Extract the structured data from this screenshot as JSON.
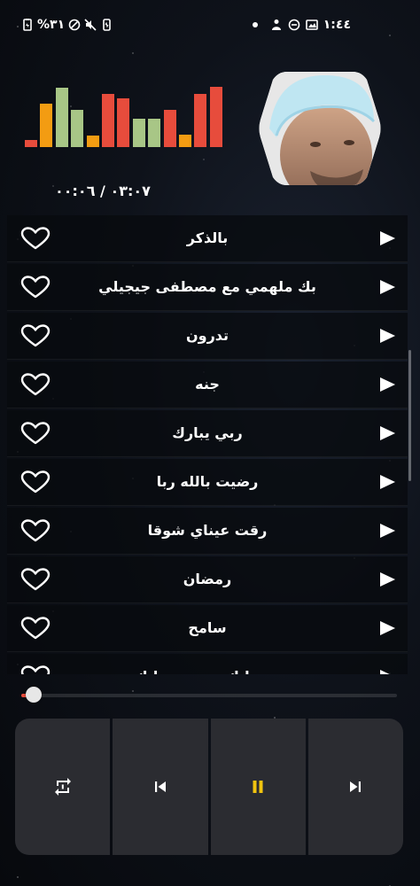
{
  "status_bar": {
    "battery": "%٣١",
    "time": "١:٤٤"
  },
  "player": {
    "time_readout": "٠٣:٠٧ / ٠٠:٠٦",
    "progress": 0.018
  },
  "visualizer": {
    "levels": [
      0.12,
      0.7,
      0.95,
      0.6,
      0.18,
      0.85,
      0.78,
      0.45,
      0.46,
      0.6,
      0.2,
      0.85,
      0.97
    ],
    "colors": [
      "#e74c3c",
      "#f39c12",
      "#a8c686",
      "#a8c686",
      "#f39c12",
      "#e74c3c",
      "#e74c3c",
      "#a8c686",
      "#a8c686",
      "#e74c3c",
      "#f39c12",
      "#e74c3c",
      "#e74c3c"
    ]
  },
  "songs": [
    {
      "title": "بالذكر"
    },
    {
      "title": "بك ملهمي مع مصطفى جيجيلي"
    },
    {
      "title": "تدرون"
    },
    {
      "title": "جنه"
    },
    {
      "title": "ربي يبارك"
    },
    {
      "title": "رضيت بالله ربا"
    },
    {
      "title": "رقت عيناي شوقا"
    },
    {
      "title": "رمضان"
    },
    {
      "title": "سامح"
    },
    {
      "title": "سبحانك ربي سبحانك"
    }
  ],
  "icons": {
    "heart": "heart-outline-icon",
    "play": "play-icon",
    "repeat": "repeat-icon",
    "previous": "skip-previous-icon",
    "pause": "pause-icon",
    "next": "skip-next-icon"
  },
  "colors": {
    "accent_red": "#e74c3c",
    "accent_yellow": "#f39c12",
    "accent_green": "#a8c686",
    "control_bg": "#2b2c31",
    "pause_color": "#f1c40f"
  }
}
